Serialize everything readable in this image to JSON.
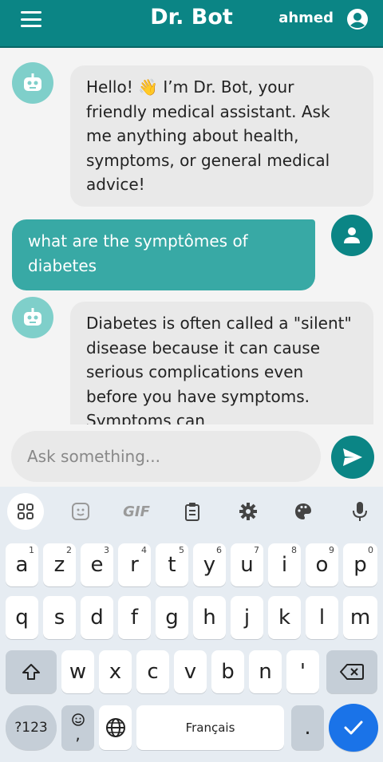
{
  "header": {
    "title": "Dr. Bot",
    "username": "ahmed"
  },
  "messages": [
    {
      "sender": "bot",
      "text": "Hello! 👋 I’m Dr. Bot, your friendly medical assistant. Ask me anything about health, symptoms, or general medical advice!"
    },
    {
      "sender": "user",
      "text": "what are the symptômes of diabetes"
    },
    {
      "sender": "bot",
      "text": "Diabetes is often called a \"silent\" disease because it can cause serious complications even before you have symptoms. Symptoms can"
    }
  ],
  "input": {
    "placeholder": "Ask something..."
  },
  "keyboard": {
    "toolbar": {
      "gif": "GIF"
    },
    "row1": [
      {
        "key": "a",
        "hint": "1"
      },
      {
        "key": "z",
        "hint": "2"
      },
      {
        "key": "e",
        "hint": "3"
      },
      {
        "key": "r",
        "hint": "4"
      },
      {
        "key": "t",
        "hint": "5"
      },
      {
        "key": "y",
        "hint": "6"
      },
      {
        "key": "u",
        "hint": "7"
      },
      {
        "key": "i",
        "hint": "8"
      },
      {
        "key": "o",
        "hint": "9"
      },
      {
        "key": "p",
        "hint": "0"
      }
    ],
    "row2": [
      "q",
      "s",
      "d",
      "f",
      "g",
      "h",
      "j",
      "k",
      "l",
      "m"
    ],
    "row3": [
      "w",
      "x",
      "c",
      "v",
      "b",
      "n",
      "'"
    ],
    "numbers_label": "?123",
    "emoji_comma": ",",
    "space_label": "Français",
    "period": "."
  }
}
